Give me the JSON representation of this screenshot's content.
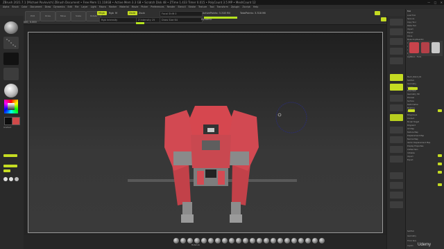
{
  "title_bar": {
    "text": "ZBrush 2021.7.1 [Michael Pavlovich]   ZBrush Document   • Free Mem 11.118GB • Active Mem 3.3 GB • Scratch Disk 48 • ZTime 1.433 Timer 0.015 • PolyCount 3.5 MP • MeshCount 12"
  },
  "menu": {
    "items": [
      "Alpha",
      "Brush",
      "Color",
      "Document",
      "Draw",
      "Dynamics",
      "Edit",
      "File",
      "Layer",
      "Light",
      "Macro",
      "Marker",
      "Material",
      "Movie",
      "Picker",
      "Preferences",
      "Render",
      "Stencil",
      "Stroke",
      "Texture",
      "Tool",
      "Transform",
      "Zplugin",
      "Zscript",
      "Help"
    ]
  },
  "toolbar": {
    "mode_buttons": [
      "Edit",
      "Draw",
      "Move",
      "Scale",
      "Rotate"
    ],
    "mrgb": "Mrgb",
    "rgb": "Rgb",
    "m": "M",
    "zadd": "Zadd",
    "zsub": "Zsub",
    "focal_label": "Focal Shift 0",
    "draw_size_label": "Draw Size 64",
    "dynamic_label": "Dynamic",
    "active_points": "ActivePoints: 3.318 Mil",
    "total_points": "TotalPoints: 3.318 Mil",
    "rgb_intensity": "Rgb Intensity",
    "z_intensity": "Z Intensity 25",
    "coords": "0.377, 0.000, 0.000, 0.000"
  },
  "right_palette": {
    "header": "Tool",
    "items": [
      "Load Tool",
      "Save As",
      "Copy Tool",
      "Paste Tool",
      "Import",
      "Export",
      "Clone",
      "Make PolyMesh3D",
      "GoZ",
      "All",
      "Visible",
      "R",
      "Lightbox › Tools",
      "Mech_Robot_01",
      "SubTool",
      "Geometry",
      "Layers",
      "FiberMesh",
      "Geometry HD",
      "Preview",
      "Surface",
      "Deformation",
      "Masking",
      "Visibility",
      "Polygroups",
      "Contact",
      "Morph Target",
      "Polypaint",
      "UV Map",
      "Texture Map",
      "Displacement Map",
      "Normal Map",
      "Vector Displacement Map",
      "Display Properties",
      "Unified Skin",
      "Initialize",
      "Import",
      "Export"
    ],
    "bottom_items": [
      "SubTool",
      "Geometry",
      "Thick Skin",
      "Layers"
    ]
  },
  "left_shelf": {
    "labels": [
      "Stroke",
      "Alpha",
      "Texture",
      "Material",
      "Gradient",
      "SwitchColor",
      "Alternate"
    ]
  },
  "bottom_bar": {
    "label": "Materials"
  },
  "watermark": "Udemy",
  "colors": {
    "accent": "#c5dc22",
    "robot_red": "#d8464f",
    "robot_grey": "#8a8a8a"
  }
}
